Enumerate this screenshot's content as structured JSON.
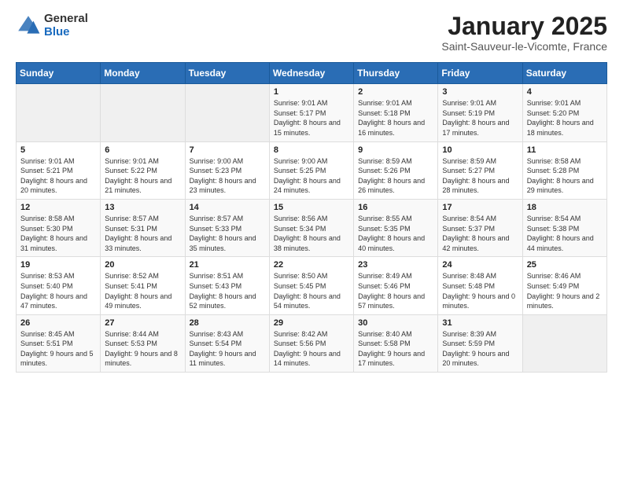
{
  "logo": {
    "general": "General",
    "blue": "Blue"
  },
  "header": {
    "title": "January 2025",
    "subtitle": "Saint-Sauveur-le-Vicomte, France"
  },
  "weekdays": [
    "Sunday",
    "Monday",
    "Tuesday",
    "Wednesday",
    "Thursday",
    "Friday",
    "Saturday"
  ],
  "weeks": [
    [
      {
        "day": "",
        "sunrise": "",
        "sunset": "",
        "daylight": ""
      },
      {
        "day": "",
        "sunrise": "",
        "sunset": "",
        "daylight": ""
      },
      {
        "day": "",
        "sunrise": "",
        "sunset": "",
        "daylight": ""
      },
      {
        "day": "1",
        "sunrise": "Sunrise: 9:01 AM",
        "sunset": "Sunset: 5:17 PM",
        "daylight": "Daylight: 8 hours and 15 minutes."
      },
      {
        "day": "2",
        "sunrise": "Sunrise: 9:01 AM",
        "sunset": "Sunset: 5:18 PM",
        "daylight": "Daylight: 8 hours and 16 minutes."
      },
      {
        "day": "3",
        "sunrise": "Sunrise: 9:01 AM",
        "sunset": "Sunset: 5:19 PM",
        "daylight": "Daylight: 8 hours and 17 minutes."
      },
      {
        "day": "4",
        "sunrise": "Sunrise: 9:01 AM",
        "sunset": "Sunset: 5:20 PM",
        "daylight": "Daylight: 8 hours and 18 minutes."
      }
    ],
    [
      {
        "day": "5",
        "sunrise": "Sunrise: 9:01 AM",
        "sunset": "Sunset: 5:21 PM",
        "daylight": "Daylight: 8 hours and 20 minutes."
      },
      {
        "day": "6",
        "sunrise": "Sunrise: 9:01 AM",
        "sunset": "Sunset: 5:22 PM",
        "daylight": "Daylight: 8 hours and 21 minutes."
      },
      {
        "day": "7",
        "sunrise": "Sunrise: 9:00 AM",
        "sunset": "Sunset: 5:23 PM",
        "daylight": "Daylight: 8 hours and 23 minutes."
      },
      {
        "day": "8",
        "sunrise": "Sunrise: 9:00 AM",
        "sunset": "Sunset: 5:25 PM",
        "daylight": "Daylight: 8 hours and 24 minutes."
      },
      {
        "day": "9",
        "sunrise": "Sunrise: 8:59 AM",
        "sunset": "Sunset: 5:26 PM",
        "daylight": "Daylight: 8 hours and 26 minutes."
      },
      {
        "day": "10",
        "sunrise": "Sunrise: 8:59 AM",
        "sunset": "Sunset: 5:27 PM",
        "daylight": "Daylight: 8 hours and 28 minutes."
      },
      {
        "day": "11",
        "sunrise": "Sunrise: 8:58 AM",
        "sunset": "Sunset: 5:28 PM",
        "daylight": "Daylight: 8 hours and 29 minutes."
      }
    ],
    [
      {
        "day": "12",
        "sunrise": "Sunrise: 8:58 AM",
        "sunset": "Sunset: 5:30 PM",
        "daylight": "Daylight: 8 hours and 31 minutes."
      },
      {
        "day": "13",
        "sunrise": "Sunrise: 8:57 AM",
        "sunset": "Sunset: 5:31 PM",
        "daylight": "Daylight: 8 hours and 33 minutes."
      },
      {
        "day": "14",
        "sunrise": "Sunrise: 8:57 AM",
        "sunset": "Sunset: 5:33 PM",
        "daylight": "Daylight: 8 hours and 35 minutes."
      },
      {
        "day": "15",
        "sunrise": "Sunrise: 8:56 AM",
        "sunset": "Sunset: 5:34 PM",
        "daylight": "Daylight: 8 hours and 38 minutes."
      },
      {
        "day": "16",
        "sunrise": "Sunrise: 8:55 AM",
        "sunset": "Sunset: 5:35 PM",
        "daylight": "Daylight: 8 hours and 40 minutes."
      },
      {
        "day": "17",
        "sunrise": "Sunrise: 8:54 AM",
        "sunset": "Sunset: 5:37 PM",
        "daylight": "Daylight: 8 hours and 42 minutes."
      },
      {
        "day": "18",
        "sunrise": "Sunrise: 8:54 AM",
        "sunset": "Sunset: 5:38 PM",
        "daylight": "Daylight: 8 hours and 44 minutes."
      }
    ],
    [
      {
        "day": "19",
        "sunrise": "Sunrise: 8:53 AM",
        "sunset": "Sunset: 5:40 PM",
        "daylight": "Daylight: 8 hours and 47 minutes."
      },
      {
        "day": "20",
        "sunrise": "Sunrise: 8:52 AM",
        "sunset": "Sunset: 5:41 PM",
        "daylight": "Daylight: 8 hours and 49 minutes."
      },
      {
        "day": "21",
        "sunrise": "Sunrise: 8:51 AM",
        "sunset": "Sunset: 5:43 PM",
        "daylight": "Daylight: 8 hours and 52 minutes."
      },
      {
        "day": "22",
        "sunrise": "Sunrise: 8:50 AM",
        "sunset": "Sunset: 5:45 PM",
        "daylight": "Daylight: 8 hours and 54 minutes."
      },
      {
        "day": "23",
        "sunrise": "Sunrise: 8:49 AM",
        "sunset": "Sunset: 5:46 PM",
        "daylight": "Daylight: 8 hours and 57 minutes."
      },
      {
        "day": "24",
        "sunrise": "Sunrise: 8:48 AM",
        "sunset": "Sunset: 5:48 PM",
        "daylight": "Daylight: 9 hours and 0 minutes."
      },
      {
        "day": "25",
        "sunrise": "Sunrise: 8:46 AM",
        "sunset": "Sunset: 5:49 PM",
        "daylight": "Daylight: 9 hours and 2 minutes."
      }
    ],
    [
      {
        "day": "26",
        "sunrise": "Sunrise: 8:45 AM",
        "sunset": "Sunset: 5:51 PM",
        "daylight": "Daylight: 9 hours and 5 minutes."
      },
      {
        "day": "27",
        "sunrise": "Sunrise: 8:44 AM",
        "sunset": "Sunset: 5:53 PM",
        "daylight": "Daylight: 9 hours and 8 minutes."
      },
      {
        "day": "28",
        "sunrise": "Sunrise: 8:43 AM",
        "sunset": "Sunset: 5:54 PM",
        "daylight": "Daylight: 9 hours and 11 minutes."
      },
      {
        "day": "29",
        "sunrise": "Sunrise: 8:42 AM",
        "sunset": "Sunset: 5:56 PM",
        "daylight": "Daylight: 9 hours and 14 minutes."
      },
      {
        "day": "30",
        "sunrise": "Sunrise: 8:40 AM",
        "sunset": "Sunset: 5:58 PM",
        "daylight": "Daylight: 9 hours and 17 minutes."
      },
      {
        "day": "31",
        "sunrise": "Sunrise: 8:39 AM",
        "sunset": "Sunset: 5:59 PM",
        "daylight": "Daylight: 9 hours and 20 minutes."
      },
      {
        "day": "",
        "sunrise": "",
        "sunset": "",
        "daylight": ""
      }
    ]
  ]
}
